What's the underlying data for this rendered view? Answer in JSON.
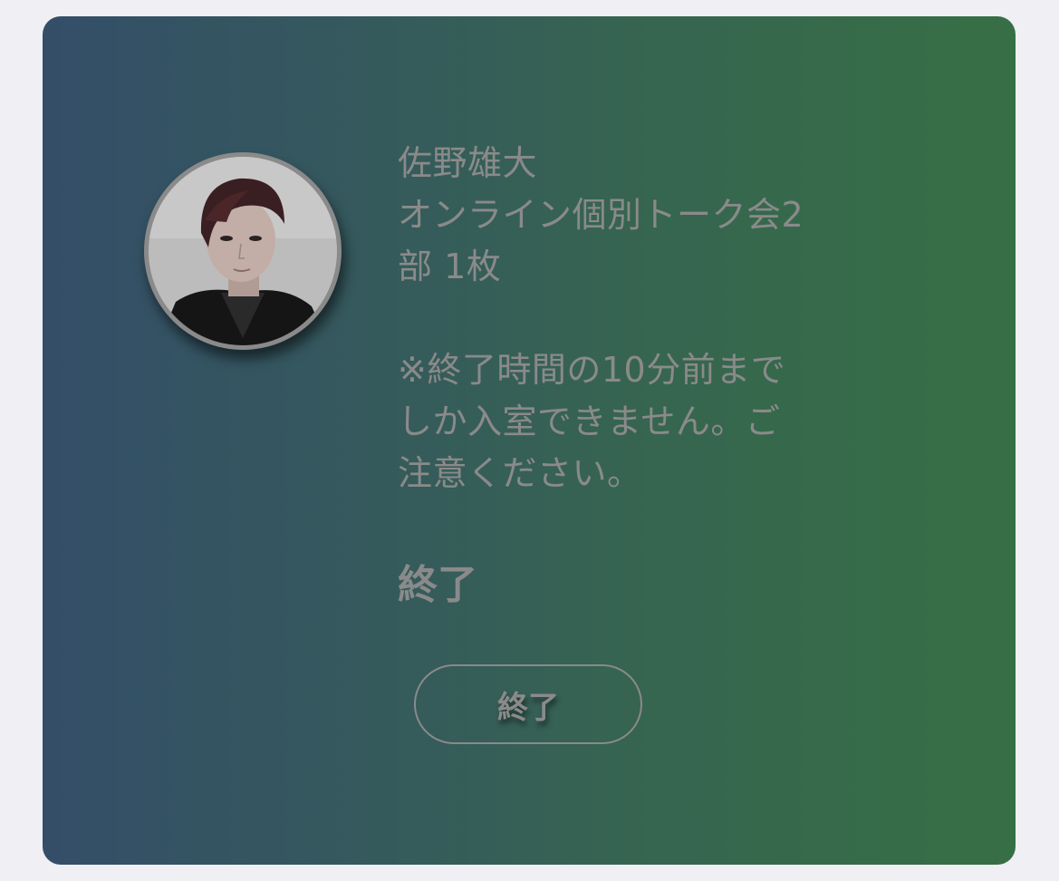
{
  "ticket": {
    "artist": "佐野雄大",
    "event_line1": "オンライン個別トーク会2",
    "event_line2": "部 1枚",
    "notice_line1": "※終了時間の10分前まで",
    "notice_line2": "しか入室できません。ご",
    "notice_line3": "注意ください。",
    "status": "終了",
    "button_label": "終了"
  },
  "colors": {
    "page_bg": "#efeff4",
    "gradient_start": "#344e68",
    "gradient_end": "#376f45",
    "text": "#8a8a8a"
  },
  "icons": {
    "avatar": "artist-photo-avatar"
  }
}
